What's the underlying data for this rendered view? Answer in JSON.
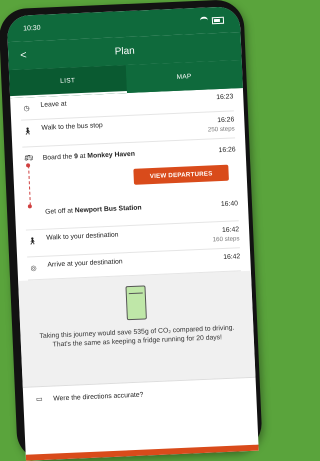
{
  "status": {
    "time": "10:30"
  },
  "header": {
    "title": "Plan",
    "back_symbol": "<"
  },
  "tabs": [
    {
      "label": "LIST"
    },
    {
      "label": "MAP"
    }
  ],
  "steps": {
    "leave": {
      "label": "Leave at",
      "time": "16:23"
    },
    "walk_bus": {
      "label": "Walk to the bus stop",
      "time": "16:26",
      "steps": "250 steps"
    },
    "board": {
      "prefix": "Board the",
      "route": "9",
      "at": "at",
      "stop": "Monkey Haven",
      "time": "16:26"
    },
    "departures_button": "VIEW DEPARTURES",
    "get_off": {
      "prefix": "Get off at",
      "stop": "Newport Bus Station",
      "time": "16:40"
    },
    "walk_dest": {
      "label": "Walk to your destination",
      "time": "16:42",
      "steps": "160 steps"
    },
    "arrive": {
      "label": "Arrive at your destination",
      "time": "16:42"
    }
  },
  "eco": {
    "text": "Taking this journey would save 535g of CO₂ compared to driving. That's the same as keeping a fridge running for 20 days!"
  },
  "feedback": {
    "question": "Were the directions accurate?"
  },
  "colors": {
    "brand_green": "#0f6a3c",
    "accent_orange": "#d94b1b",
    "background_green": "#5aa43c"
  }
}
